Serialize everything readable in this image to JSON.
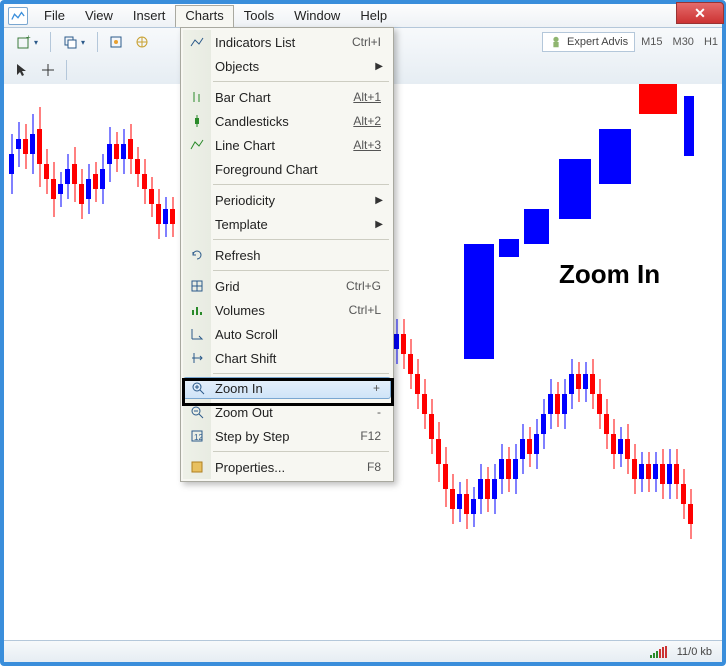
{
  "menu": {
    "file": "File",
    "view": "View",
    "insert": "Insert",
    "charts": "Charts",
    "tools": "Tools",
    "window": "Window",
    "help": "Help"
  },
  "toolbar": {
    "expert": "Expert Advis",
    "tf": [
      "M15",
      "M30",
      "H1"
    ]
  },
  "dropdown": {
    "indicators": {
      "label": "Indicators List",
      "sc": "Ctrl+I"
    },
    "objects": "Objects",
    "bar": {
      "label": "Bar Chart",
      "sc": "Alt+1"
    },
    "candle": {
      "label": "Candlesticks",
      "sc": "Alt+2"
    },
    "line": {
      "label": "Line Chart",
      "sc": "Alt+3"
    },
    "fg": "Foreground Chart",
    "period": "Periodicity",
    "template": "Template",
    "refresh": "Refresh",
    "grid": {
      "label": "Grid",
      "sc": "Ctrl+G"
    },
    "volumes": {
      "label": "Volumes",
      "sc": "Ctrl+L"
    },
    "autoscroll": "Auto Scroll",
    "shift": "Chart Shift",
    "zoomin": {
      "label": "Zoom In",
      "sc": "+"
    },
    "zoomout": {
      "label": "Zoom Out",
      "sc": "-"
    },
    "step": {
      "label": "Step by Step",
      "sc": "F12"
    },
    "props": {
      "label": "Properties...",
      "sc": "F8"
    }
  },
  "annotation": "Zoom In",
  "status": {
    "kb": "11/0 kb"
  }
}
